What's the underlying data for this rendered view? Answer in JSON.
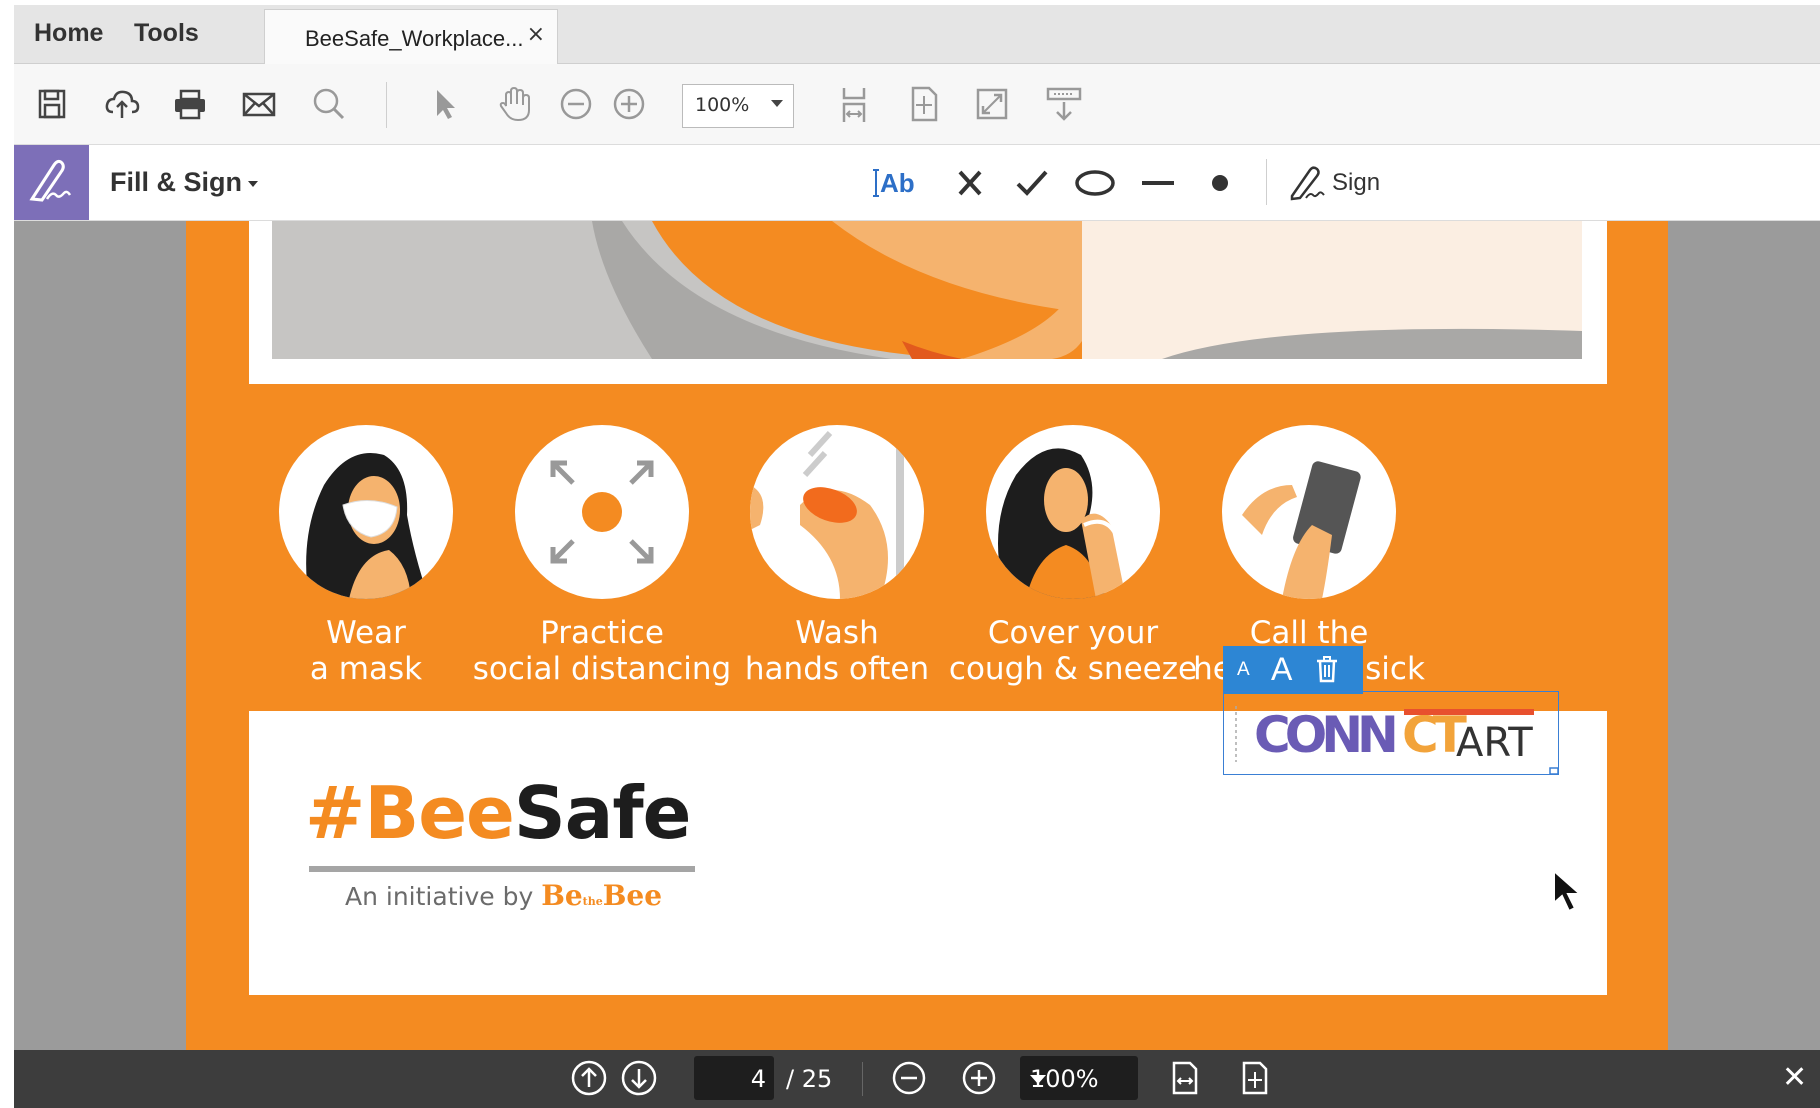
{
  "tabs": {
    "home": "Home",
    "tools": "Tools",
    "document": "BeeSafe_Workplace...",
    "close_symbol": "×"
  },
  "toolbar": {
    "zoom": "100%"
  },
  "fill_sign": {
    "title": "Fill & Sign",
    "text_tool": "Ab",
    "sign_label": "Sign"
  },
  "document": {
    "tips": [
      {
        "line1": "Wear",
        "line2": "a mask"
      },
      {
        "line1": "Practice",
        "line2": "social distancing"
      },
      {
        "line1": "Wash",
        "line2": "hands often"
      },
      {
        "line1": "Cover your",
        "line2": "cough & sneeze"
      },
      {
        "line1": "Call the",
        "line2": "helpline, if sick"
      }
    ],
    "brand": {
      "hash": "#Bee",
      "safe": "Safe",
      "initiative": "An initiative by",
      "be1": "Be",
      "the": "the",
      "be2": "Bee"
    },
    "signature": {
      "part1": "CONN",
      "part2": "CT",
      "part3": "ART"
    },
    "mini_toolbar": {
      "small": "A",
      "large": "A"
    }
  },
  "bottom_nav": {
    "current_page": "4",
    "total_pages": "/ 25",
    "zoom": "100%",
    "close_symbol": "✕"
  },
  "colors": {
    "accent_orange": "#f48b21",
    "fill_sign_purple": "#7d6fb8",
    "selection_blue": "#2d86d4"
  }
}
